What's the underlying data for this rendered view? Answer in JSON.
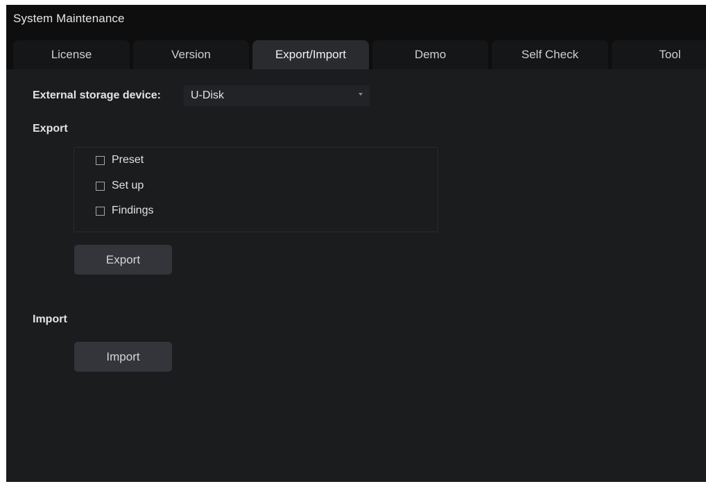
{
  "window": {
    "title": "System Maintenance"
  },
  "tabs": [
    {
      "label": "License",
      "active": false
    },
    {
      "label": "Version",
      "active": false
    },
    {
      "label": "Export/Import",
      "active": true
    },
    {
      "label": "Demo",
      "active": false
    },
    {
      "label": "Self Check",
      "active": false
    },
    {
      "label": "Tool",
      "active": false
    }
  ],
  "storage": {
    "label": "External storage device:",
    "selected": "U-Disk"
  },
  "export": {
    "heading": "Export",
    "options": [
      {
        "label": "Preset",
        "checked": false
      },
      {
        "label": "Set up",
        "checked": false
      },
      {
        "label": "Findings",
        "checked": false
      }
    ],
    "button_label": "Export"
  },
  "import": {
    "heading": "Import",
    "button_label": "Import"
  },
  "colors": {
    "background": "#1b1c1e",
    "title_bar": "#0e0e0f",
    "tab_inactive": "#151618",
    "tab_active": "#2a2b2e",
    "button": "#33353a"
  }
}
